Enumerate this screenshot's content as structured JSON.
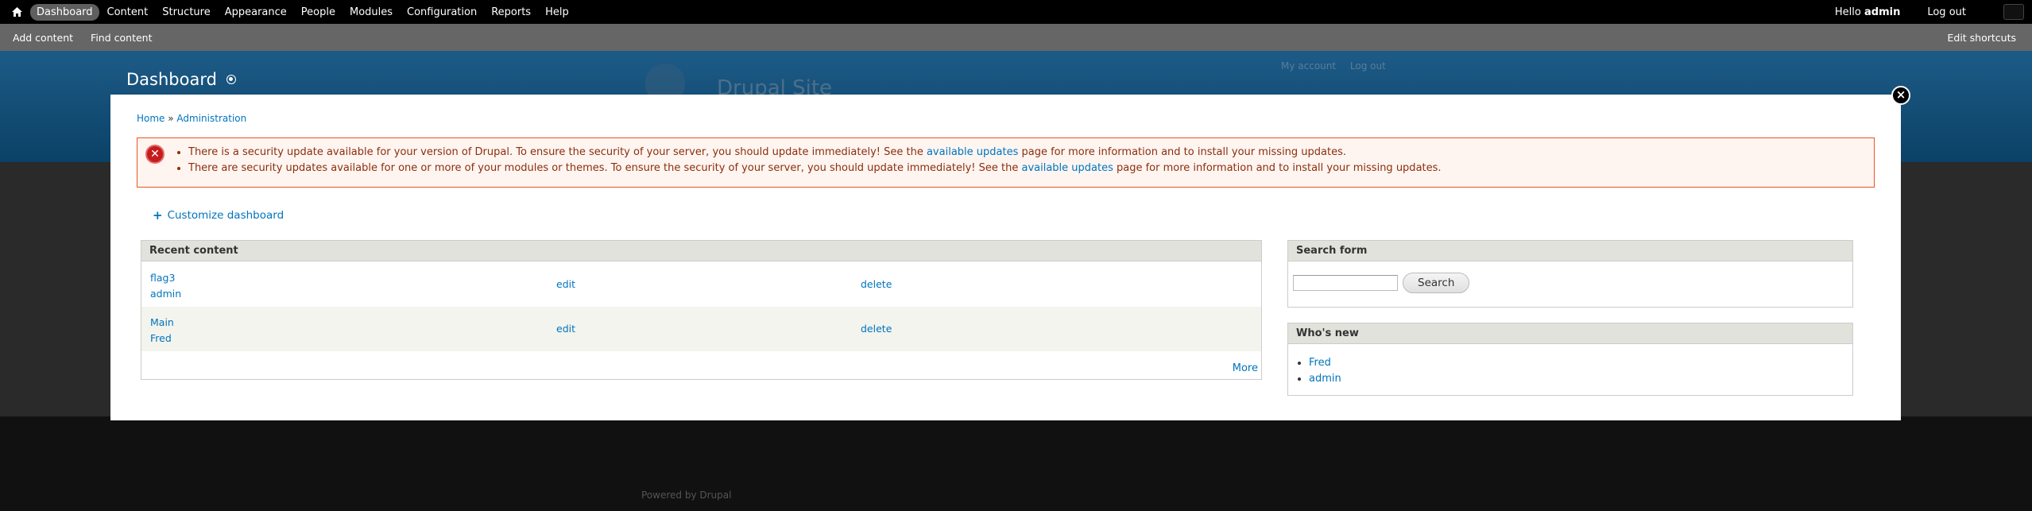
{
  "toolbar": {
    "menu": [
      {
        "label": "Dashboard",
        "active": true
      },
      {
        "label": "Content"
      },
      {
        "label": "Structure"
      },
      {
        "label": "Appearance"
      },
      {
        "label": "People"
      },
      {
        "label": "Modules"
      },
      {
        "label": "Configuration"
      },
      {
        "label": "Reports"
      },
      {
        "label": "Help"
      }
    ],
    "hello_prefix": "Hello ",
    "username": "admin",
    "logout_label": "Log out"
  },
  "shortcuts": {
    "items": [
      "Add content",
      "Find content"
    ],
    "edit_label": "Edit shortcuts"
  },
  "background": {
    "site_name": "Drupal Site",
    "my_account": "My account",
    "log_out": "Log out",
    "powered_prefix": "Powered by ",
    "powered_link": "Drupal"
  },
  "page": {
    "title": "Dashboard",
    "breadcrumb": [
      "Home",
      "Administration"
    ],
    "breadcrumb_sep": " » "
  },
  "messages": [
    {
      "before": "There is a security update available for your version of Drupal. To ensure the security of your server, you should update immediately! See the ",
      "link": "available updates",
      "after": " page for more information and to install your missing updates."
    },
    {
      "before": "There are security updates available for one or more of your modules or themes. To ensure the security of your server, you should update immediately! See the ",
      "link": "available updates",
      "after": " page for more information and to install your missing updates."
    }
  ],
  "customize_label": "Customize dashboard",
  "recent_content": {
    "title": "Recent content",
    "rows": [
      {
        "title": "flag3",
        "author": "admin",
        "edit": "edit",
        "delete": "delete"
      },
      {
        "title": "Main",
        "author": "Fred",
        "edit": "edit",
        "delete": "delete"
      }
    ],
    "more_label": "More"
  },
  "search_block": {
    "title": "Search form",
    "input_value": "",
    "button_label": "Search"
  },
  "whos_new": {
    "title": "Who's new",
    "users": [
      "Fred",
      "admin"
    ]
  },
  "colors": {
    "link": "#0074bd",
    "error_border": "#ed541d",
    "error_text": "#8c2e0b",
    "toolbar_bg": "#000000"
  }
}
